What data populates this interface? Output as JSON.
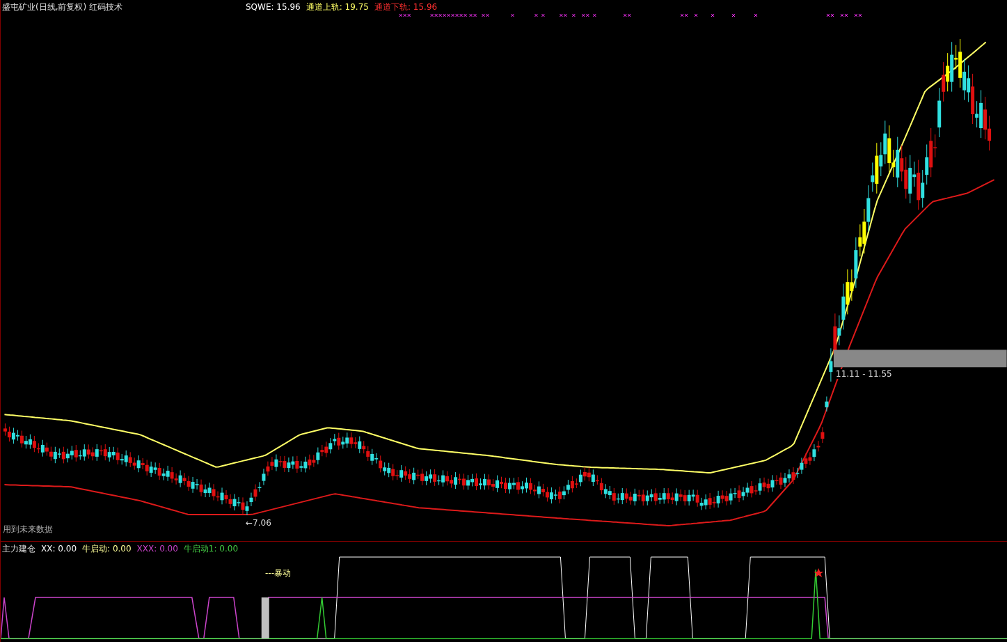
{
  "main_panel": {
    "title": "盛屯矿业(日线,前复权) 红码技术",
    "indicators": [
      {
        "text": "SQWE: 15.96",
        "color": "#ffffff"
      },
      {
        "text": "通道上轨: 19.75",
        "color": "#ffff66"
      },
      {
        "text": "通道下轨: 15.96",
        "color": "#ff3030"
      }
    ],
    "low_marker": "←7.06",
    "range_label": "11.11 - 11.55",
    "warning": "用到未来数据"
  },
  "sub_panel": {
    "title": "主力建仓",
    "indicators": [
      {
        "text": "XX: 0.00",
        "color": "#ffffff"
      },
      {
        "text": "牛启动: 0.00",
        "color": "#ffff99"
      },
      {
        "text": "XXX: 0.00",
        "color": "#cc44cc"
      },
      {
        "text": "牛启动1: 0.00",
        "color": "#44cc44"
      }
    ],
    "signal_label": "---暴动"
  }
}
